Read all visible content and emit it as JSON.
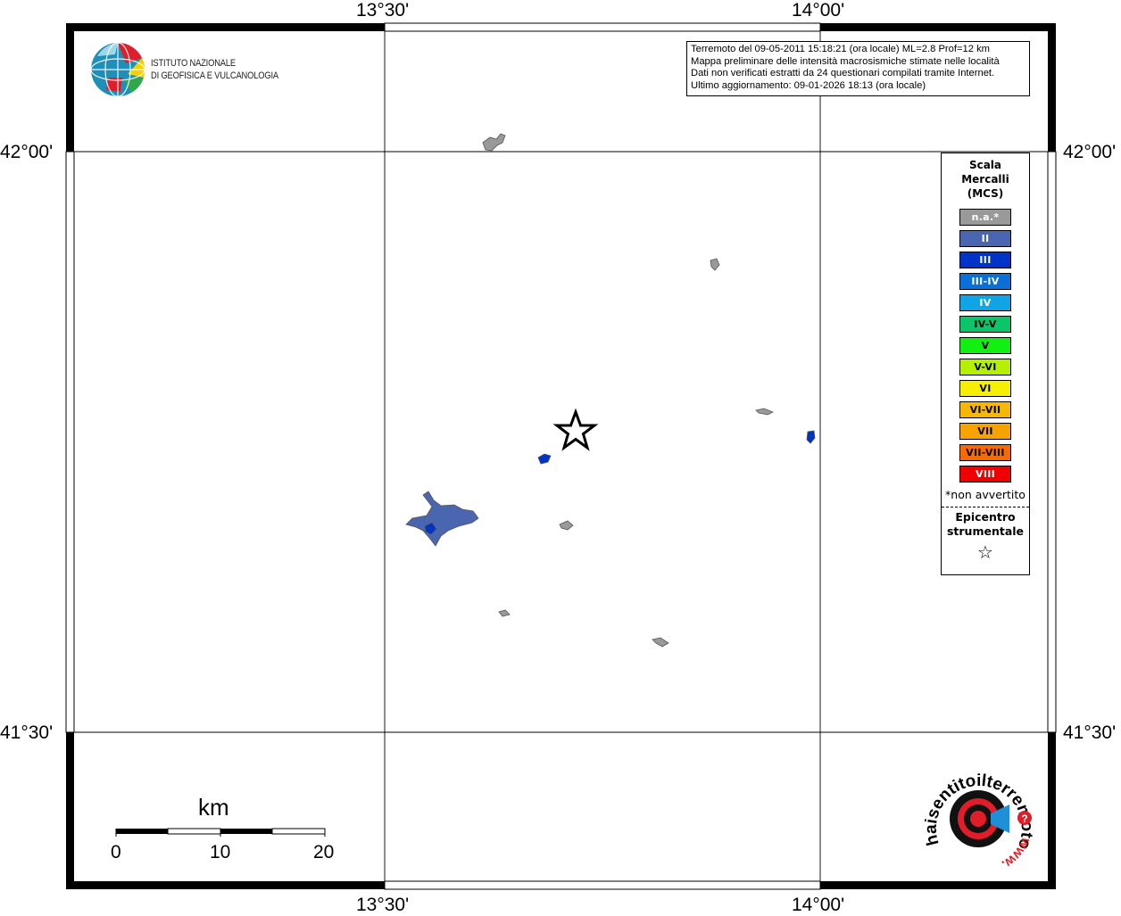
{
  "map": {
    "lon_ticks": [
      "13°30'",
      "14°00'"
    ],
    "lat_ticks": [
      "42°00'",
      "41°30'"
    ]
  },
  "info": {
    "line1": "Terremoto del 09-05-2011 15:18:21 (ora locale) ML=2.8 Prof=12 km",
    "line2": "Mappa preliminare delle intensità macrosismiche stimate nelle località",
    "line3": "Dati non verificati estratti da 24 questionari compilati tramite Internet.",
    "line4": "Ultimo aggiornamento: 09-01-2026 18:13 (ora locale)"
  },
  "legend": {
    "title": "Scala\nMercalli\n(MCS)",
    "items": [
      {
        "label": "n.a.*",
        "color": "#999999",
        "text_color": "#ffffff"
      },
      {
        "label": "II",
        "color": "#4a66b0",
        "text_color": "#ffffff"
      },
      {
        "label": "III",
        "color": "#0033c8",
        "text_color": "#ffffff"
      },
      {
        "label": "III-IV",
        "color": "#0a6fd6",
        "text_color": "#ffffff"
      },
      {
        "label": "IV",
        "color": "#10a3e6",
        "text_color": "#ffffff"
      },
      {
        "label": "IV-V",
        "color": "#0cc46a",
        "text_color": "#000000"
      },
      {
        "label": "V",
        "color": "#12f012",
        "text_color": "#000000"
      },
      {
        "label": "V-VI",
        "color": "#b4f000",
        "text_color": "#000000"
      },
      {
        "label": "VI",
        "color": "#f6f000",
        "text_color": "#000000"
      },
      {
        "label": "VI-VII",
        "color": "#f6b800",
        "text_color": "#000000"
      },
      {
        "label": "VII",
        "color": "#f6a300",
        "text_color": "#000000"
      },
      {
        "label": "VII-VIII",
        "color": "#f66a00",
        "text_color": "#000000"
      },
      {
        "label": "VIII",
        "color": "#f00000",
        "text_color": "#ffffff"
      }
    ],
    "note": "*non avvertito",
    "epicenter_label": "Epicentro\nstrumentale",
    "epicenter_symbol": "☆"
  },
  "scale_bar": {
    "unit": "km",
    "labels": [
      "0",
      "10",
      "20"
    ]
  },
  "logos": {
    "ingv_text": "ISTITUTO NAZIONALE\nDI GEOFISICA E VULCANOLOGIA",
    "hai_sentito": "haisentitoilterremoto.it",
    "www": "www."
  },
  "colors": {
    "not_felt": "#999999",
    "intensity_II": "#4a66b0",
    "intensity_III": "#0033c8"
  }
}
